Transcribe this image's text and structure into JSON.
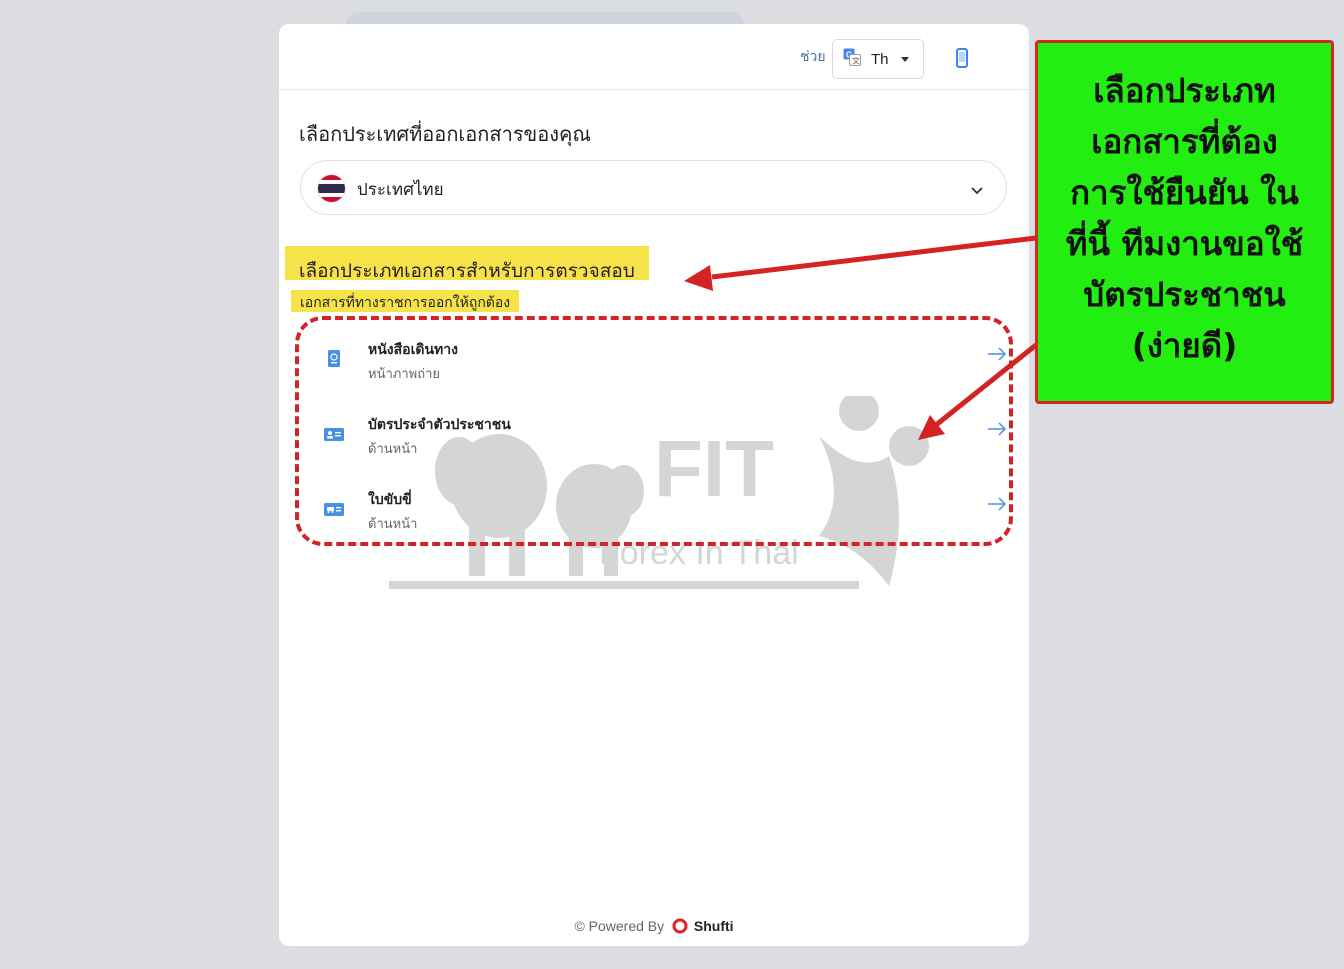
{
  "header": {
    "help_label": "ช่วย",
    "language": {
      "selected": "Th",
      "icon": "translate-icon"
    },
    "device_icon": "mobile-phone-icon"
  },
  "country": {
    "title": "เลือกประเทศที่ออกเอกสารของคุณ",
    "selected": "ประเทศไทย",
    "flag": "thailand-flag-icon"
  },
  "document_section": {
    "title": "เลือกประเภทเอกสารสำหรับการตรวจสอบ",
    "subtitle": "เอกสารที่ทางราชการออกให้ถูกต้อง",
    "items": [
      {
        "label": "หนังสือเดินทาง",
        "sub": "หน้าภาพถ่าย",
        "icon": "passport-icon"
      },
      {
        "label": "บัตรประจำตัวประชาชน",
        "sub": "ด้านหน้า",
        "icon": "id-card-icon"
      },
      {
        "label": "ใบขับขี่",
        "sub": "ด้านหน้า",
        "icon": "driving-license-icon"
      }
    ]
  },
  "watermark": {
    "main": "FIT",
    "sub": "Forex In Thai"
  },
  "footer": {
    "powered_by": "© Powered By",
    "brand": "Shufti"
  },
  "annotation": {
    "lines": [
      "เลือกประเภท",
      "เอกสารที่ต้อง",
      "การใช้ยืนยัน ใน",
      "ที่นี้ ทีมงานขอใช้",
      "บัตรประชาชน",
      "(ง่ายดี)"
    ],
    "colors": {
      "background": "#22ee11",
      "border": "#cc2a22",
      "arrow": "#d32323"
    }
  },
  "colors": {
    "page_bg": "#dcdde0",
    "card_bg": "#ffffff",
    "highlight": "#f7e24a",
    "accent_blue": "#4a90e2"
  }
}
